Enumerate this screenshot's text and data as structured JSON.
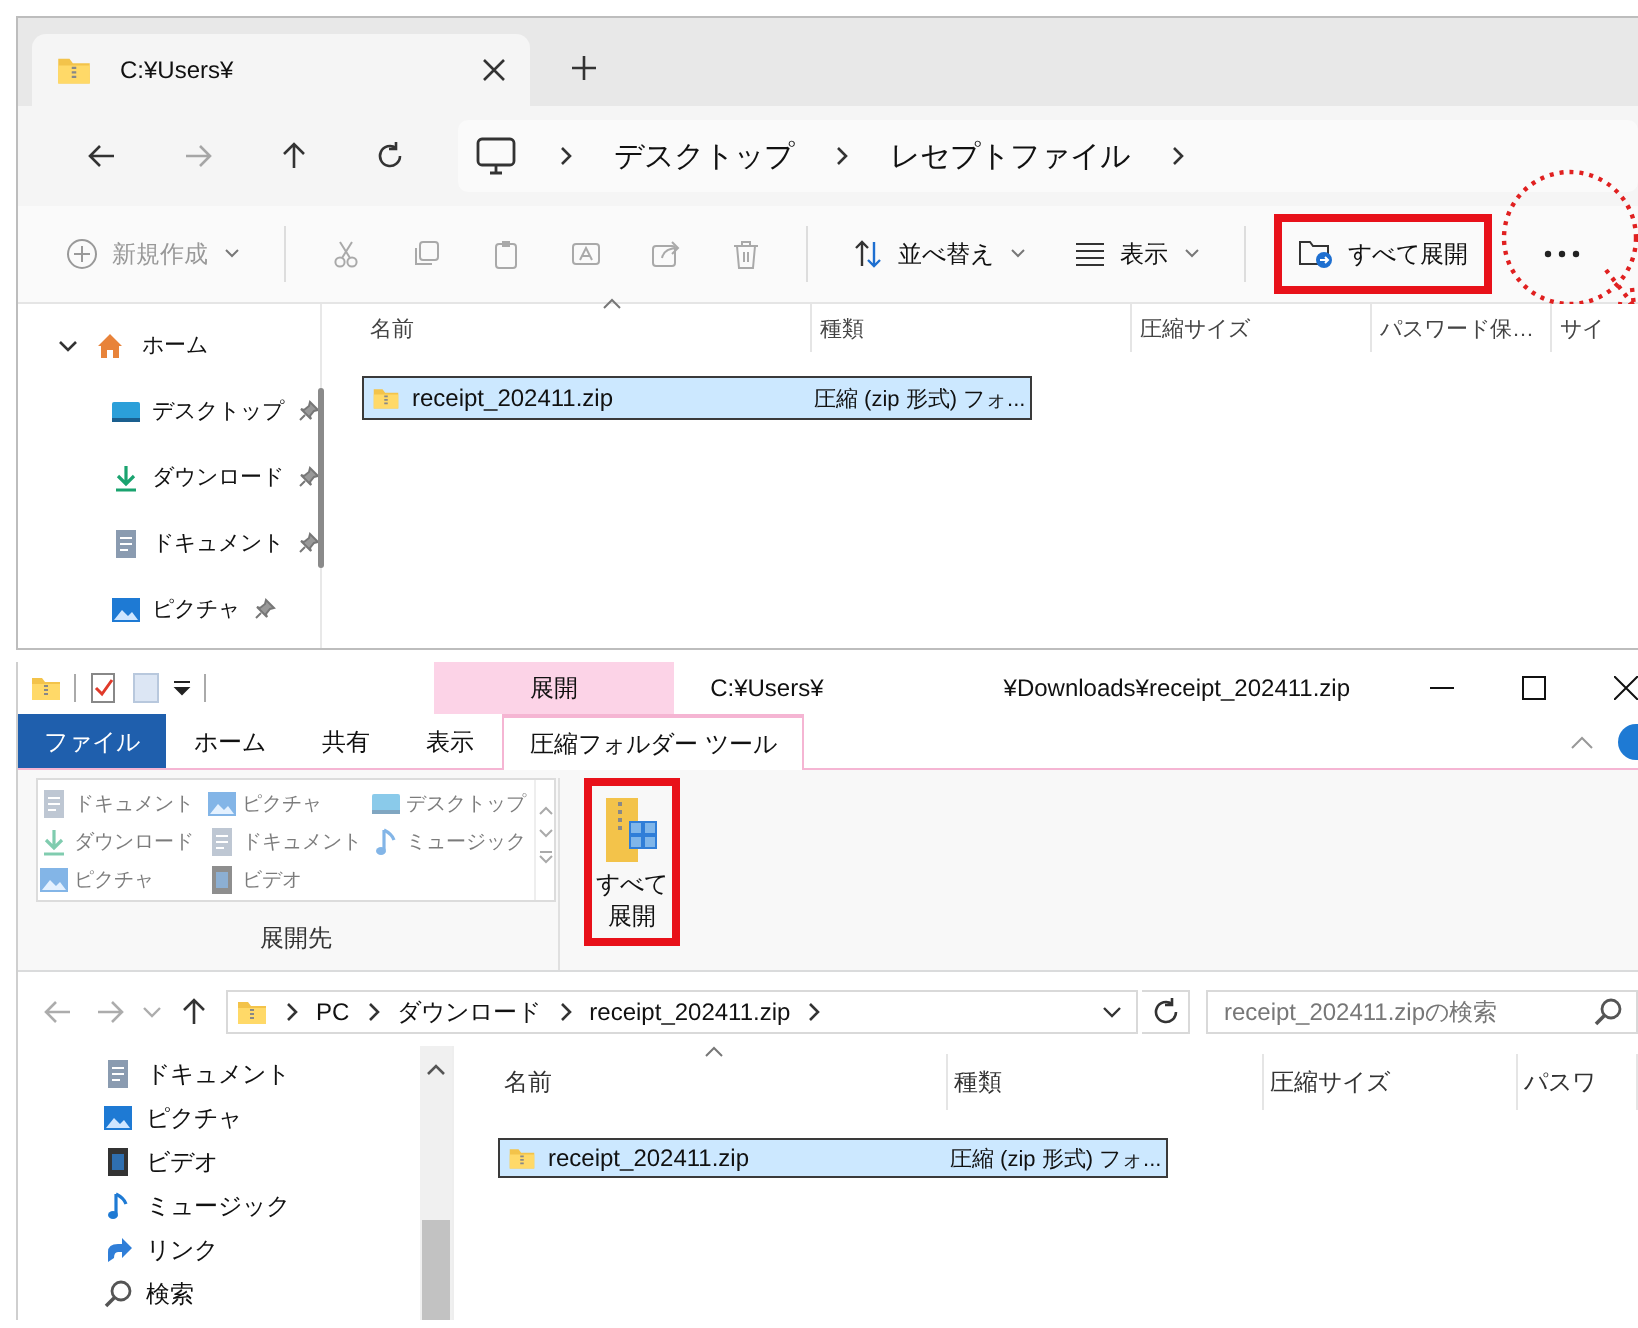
{
  "top_window": {
    "tab": {
      "title": "C:¥Users¥"
    },
    "nav_buttons": [
      {
        "kind": "back",
        "disabled": false
      },
      {
        "kind": "forward",
        "disabled": true
      },
      {
        "kind": "up",
        "disabled": false
      },
      {
        "kind": "refresh",
        "disabled": false
      }
    ],
    "breadcrumbs": [
      "デスクトップ",
      "レセプトファイル"
    ],
    "toolbar": {
      "new": {
        "label": "新規作成",
        "disabled": true
      },
      "actions": [
        {
          "kind": "cut",
          "disabled": true
        },
        {
          "kind": "copy",
          "disabled": true
        },
        {
          "kind": "paste",
          "disabled": true
        },
        {
          "kind": "rename",
          "disabled": true
        },
        {
          "kind": "share",
          "disabled": true
        },
        {
          "kind": "delete",
          "disabled": true
        }
      ],
      "sort": "並べ替え",
      "view": "表示",
      "extract_all": {
        "label": "すべて展開",
        "highlighted": true
      }
    },
    "sidebar": [
      {
        "label": "ホーム",
        "kind": "home",
        "expanded": true,
        "pinned": false
      },
      {
        "label": "デスクトップ",
        "kind": "desktop",
        "pinned": true
      },
      {
        "label": "ダウンロード",
        "kind": "download",
        "pinned": true
      },
      {
        "label": "ドキュメント",
        "kind": "document",
        "pinned": true
      },
      {
        "label": "ピクチャ",
        "kind": "picture",
        "pinned": true
      }
    ],
    "columns": [
      "名前",
      "種類",
      "圧縮サイズ",
      "パスワード保…",
      "サイ"
    ],
    "files": [
      {
        "name": "receipt_202411.zip",
        "type": "圧縮 (zip 形式) フォ...",
        "selected": true
      }
    ]
  },
  "bottom_window": {
    "context_tab": "展開",
    "title_parts": [
      "C:¥Users¥",
      "¥Downloads¥receipt_202411.zip"
    ],
    "ribbon_tabs": [
      {
        "label": "ファイル",
        "kind": "file",
        "selected": false
      },
      {
        "label": "ホーム",
        "kind": "tab",
        "selected": false
      },
      {
        "label": "共有",
        "kind": "tab",
        "selected": false
      },
      {
        "label": "表示",
        "kind": "tab",
        "selected": false
      },
      {
        "label": "圧縮フォルダー ツール",
        "kind": "tab",
        "selected": true
      }
    ],
    "destinations": {
      "disabled": true,
      "items": [
        {
          "label": "ドキュメント",
          "kind": "document"
        },
        {
          "label": "ピクチャ",
          "kind": "picture"
        },
        {
          "label": "デスクトップ",
          "kind": "desktop"
        },
        {
          "label": "ダウンロード",
          "kind": "download"
        },
        {
          "label": "ドキュメント",
          "kind": "document"
        },
        {
          "label": "ミュージック",
          "kind": "music"
        },
        {
          "label": "ピクチャ",
          "kind": "picture"
        },
        {
          "label": "ビデオ",
          "kind": "video"
        }
      ],
      "group_label": "展開先"
    },
    "extract_all": {
      "label_lines": [
        "すべて",
        "展開"
      ],
      "highlighted": true
    },
    "nav_buttons": [
      {
        "kind": "back",
        "disabled": true
      },
      {
        "kind": "forward",
        "disabled": true
      },
      {
        "kind": "recent",
        "disabled": true
      },
      {
        "kind": "up",
        "disabled": false
      }
    ],
    "breadcrumbs": [
      "PC",
      "ダウンロード",
      "receipt_202411.zip"
    ],
    "search": {
      "placeholder": "receipt_202411.zipの検索"
    },
    "sidebar": [
      {
        "label": "ドキュメント",
        "kind": "document"
      },
      {
        "label": "ピクチャ",
        "kind": "picture"
      },
      {
        "label": "ビデオ",
        "kind": "video"
      },
      {
        "label": "ミュージック",
        "kind": "music"
      },
      {
        "label": "リンク",
        "kind": "link"
      },
      {
        "label": "検索",
        "kind": "search"
      }
    ],
    "columns": [
      "名前",
      "種類",
      "圧縮サイズ",
      "パスワ"
    ],
    "files": [
      {
        "name": "receipt_202411.zip",
        "type": "圧縮 (zip 形式) フォ...",
        "selected": true
      }
    ]
  }
}
